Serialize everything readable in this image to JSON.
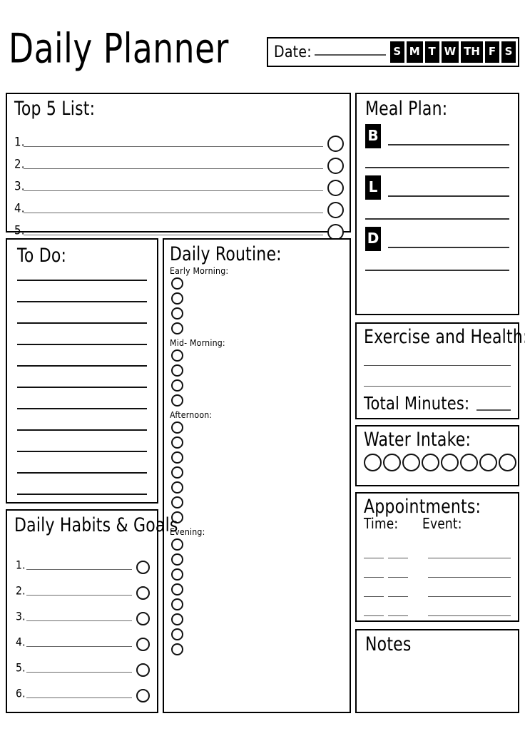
{
  "header": {
    "title": "Daily Planner",
    "date_label": "Date:",
    "days": [
      "S",
      "M",
      "T",
      "W",
      "TH",
      "F",
      "S"
    ]
  },
  "top5": {
    "title": "Top 5 List:",
    "items": [
      "1.",
      "2.",
      "3.",
      "4.",
      "5."
    ]
  },
  "todo": {
    "title": "To Do:",
    "line_count": 11
  },
  "routine": {
    "title": "Daily Routine:",
    "groups": [
      {
        "label": "Early Morning:",
        "count": 4
      },
      {
        "label": "Mid- Morning:",
        "count": 4
      },
      {
        "label": "Afternoon:",
        "count": 7
      },
      {
        "label": "Evening:",
        "count": 8
      }
    ]
  },
  "habits": {
    "title": "Daily Habits & Goals",
    "items": [
      "1.",
      "2.",
      "3.",
      "4.",
      "5.",
      "6."
    ]
  },
  "meal": {
    "title": "Meal Plan:",
    "meals": [
      {
        "badge": "B"
      },
      {
        "badge": "L"
      },
      {
        "badge": "D"
      }
    ]
  },
  "exercise": {
    "title": "Exercise and Health:",
    "line_count": 2,
    "total_label": "Total Minutes:"
  },
  "water": {
    "title": "Water Intake:",
    "glass_count": 8
  },
  "appointments": {
    "title": "Appointments:",
    "col_time": "Time:",
    "col_event": "Event:",
    "row_count": 4
  },
  "notes": {
    "title": "Notes"
  },
  "colors": {
    "ink": "#000000",
    "rule": "#555555",
    "paper": "#ffffff"
  }
}
